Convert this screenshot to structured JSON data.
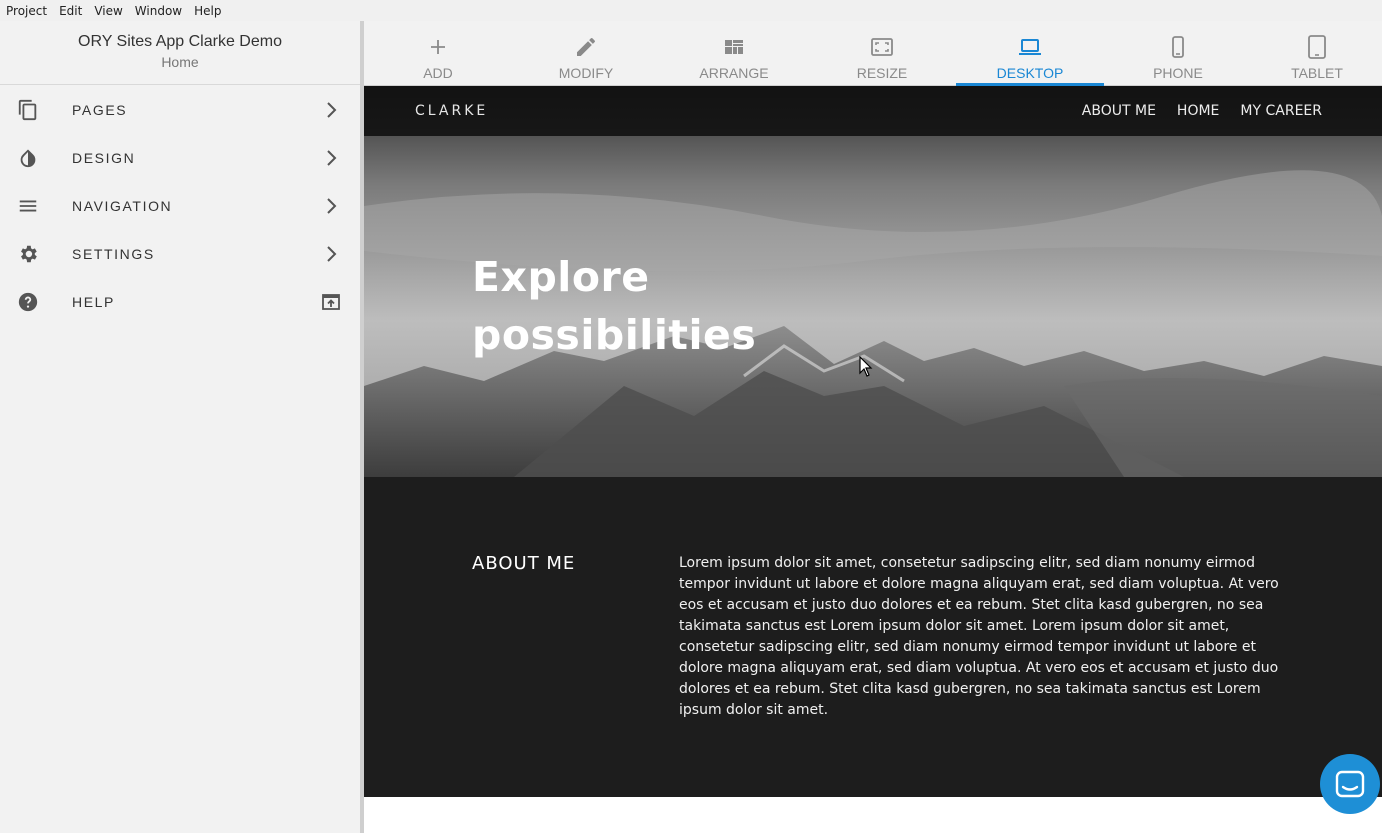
{
  "menubar": {
    "items": [
      "Project",
      "Edit",
      "View",
      "Window",
      "Help"
    ]
  },
  "project": {
    "title": "ORY Sites App Clarke Demo",
    "subtitle": "Home"
  },
  "sidebar": {
    "items": [
      {
        "label": "PAGES",
        "icon": "pages-icon"
      },
      {
        "label": "DESIGN",
        "icon": "design-icon"
      },
      {
        "label": "NAVIGATION",
        "icon": "navigation-icon"
      },
      {
        "label": "SETTINGS",
        "icon": "gear-icon"
      },
      {
        "label": "HELP",
        "icon": "help-icon"
      }
    ]
  },
  "toolbar": {
    "tools": [
      {
        "label": "ADD",
        "icon": "plus-icon"
      },
      {
        "label": "MODIFY",
        "icon": "pencil-icon"
      },
      {
        "label": "ARRANGE",
        "icon": "arrange-icon"
      },
      {
        "label": "RESIZE",
        "icon": "resize-icon"
      },
      {
        "label": "DESKTOP",
        "icon": "desktop-icon",
        "active": true
      },
      {
        "label": "PHONE",
        "icon": "phone-icon"
      },
      {
        "label": "TABLET",
        "icon": "tablet-icon"
      }
    ],
    "accent_color": "#1a87d4"
  },
  "site": {
    "brand": "CLARKE",
    "nav": [
      "ABOUT ME",
      "HOME",
      "MY CAREER"
    ],
    "hero_title": "Explore possibilities",
    "about_heading": "ABOUT ME",
    "about_text": "Lorem ipsum dolor sit amet, consetetur sadipscing elitr, sed diam nonumy eirmod tempor invidunt ut labore et dolore magna aliquyam erat, sed diam voluptua. At vero eos et accusam et justo duo dolores et ea rebum. Stet clita kasd gubergren, no sea takimata sanctus est Lorem ipsum dolor sit amet. Lorem ipsum dolor sit amet, consetetur sadipscing elitr, sed diam nonumy eirmod tempor invidunt ut labore et dolore magna aliquyam erat, sed diam voluptua. At vero eos et accusam et justo duo dolores et ea rebum. Stet clita kasd gubergren, no sea takimata sanctus est Lorem ipsum dolor sit amet."
  },
  "chat": {
    "icon": "chat-icon",
    "color": "#1e8fd6"
  }
}
